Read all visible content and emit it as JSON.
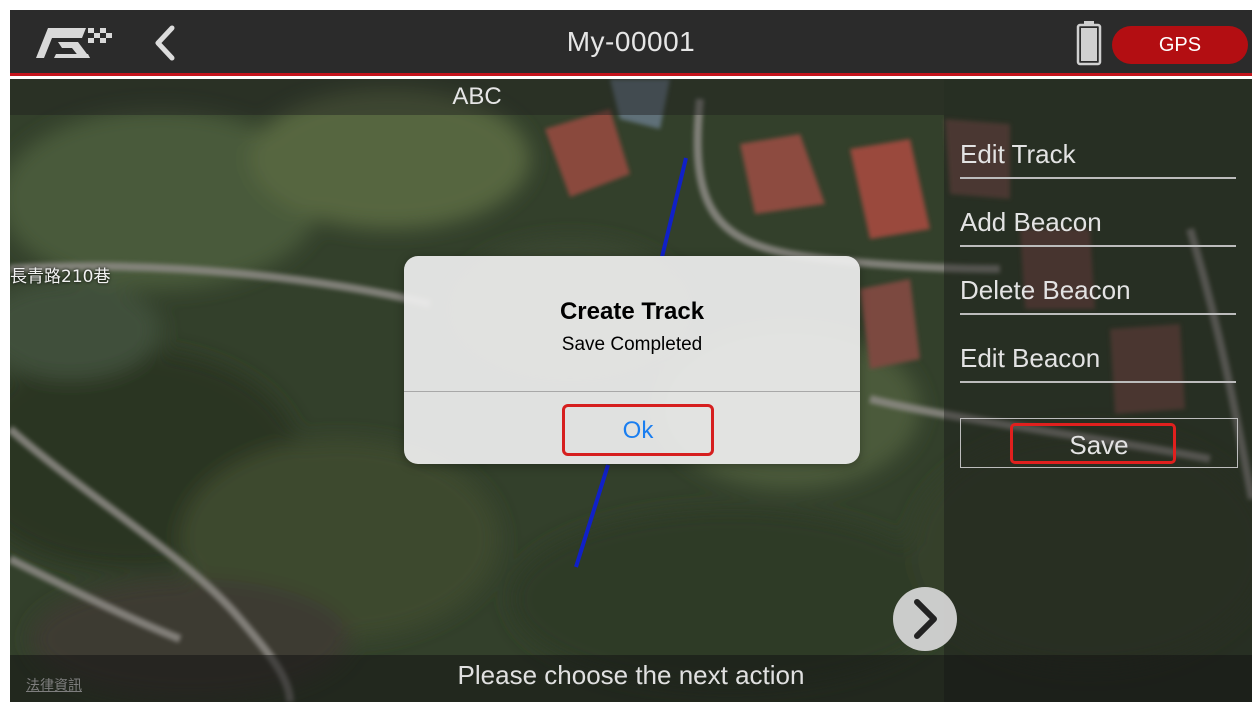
{
  "header": {
    "title": "My-00001",
    "gps_label": "GPS",
    "logo_icon": "brand-logo-icon",
    "back_icon": "chevron-left-icon",
    "battery_icon": "battery-icon"
  },
  "map": {
    "top_label": "ABC",
    "road_label": "長青路210巷",
    "legal_link": "法律資訊",
    "track_color": "#1020c8"
  },
  "side_panel": {
    "items": [
      {
        "label": "Edit Track"
      },
      {
        "label": "Add Beacon"
      },
      {
        "label": "Delete Beacon"
      },
      {
        "label": "Edit Beacon"
      }
    ],
    "save_label": "Save"
  },
  "dialog": {
    "title": "Create Track",
    "message": "Save Completed",
    "ok_label": "Ok"
  },
  "status": {
    "message": "Please choose the next action",
    "next_icon": "chevron-right-icon"
  },
  "colors": {
    "accent_red": "#c4141c",
    "gps_red": "#b30e12",
    "link_blue": "#1a7ef0",
    "highlight_red": "#e0201e"
  }
}
